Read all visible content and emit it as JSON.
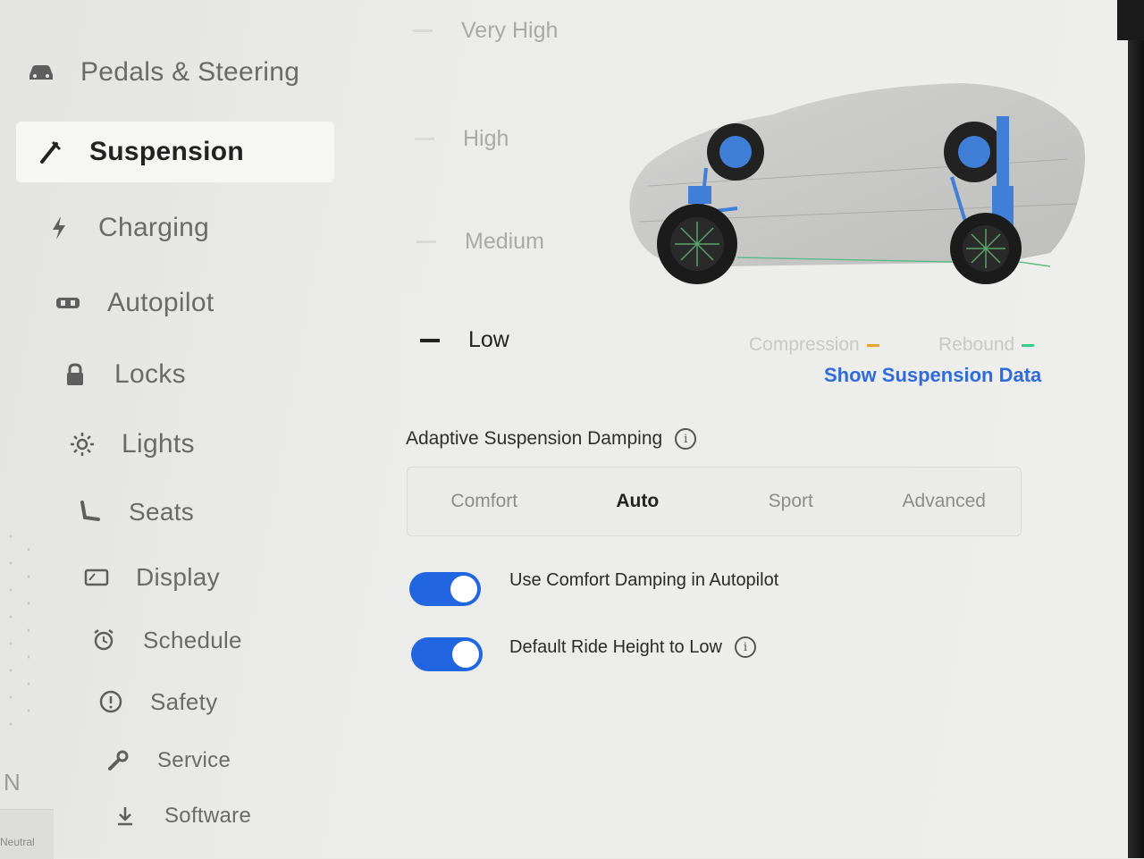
{
  "sidebar": {
    "items": [
      {
        "label": "Pedals & Steering",
        "icon": "car-icon"
      },
      {
        "label": "Suspension",
        "icon": "suspension-icon",
        "active": true
      },
      {
        "label": "Charging",
        "icon": "lightning-icon"
      },
      {
        "label": "Autopilot",
        "icon": "steering-wheel-icon"
      },
      {
        "label": "Locks",
        "icon": "lock-icon"
      },
      {
        "label": "Lights",
        "icon": "sun-icon"
      },
      {
        "label": "Seats",
        "icon": "seat-icon"
      },
      {
        "label": "Display",
        "icon": "display-icon"
      },
      {
        "label": "Schedule",
        "icon": "alarm-clock-icon"
      },
      {
        "label": "Safety",
        "icon": "info-circle-icon"
      },
      {
        "label": "Service",
        "icon": "wrench-icon"
      },
      {
        "label": "Software",
        "icon": "download-icon"
      }
    ]
  },
  "gear": {
    "letter": "N",
    "label": "Neutral"
  },
  "ride_height": {
    "options": [
      "Very High",
      "High",
      "Medium",
      "Low"
    ],
    "selected": "Low"
  },
  "suspension_data": {
    "compression_label": "Compression",
    "rebound_label": "Rebound",
    "compression_color": "#e8a23c",
    "rebound_color": "#3cc98a",
    "show_data_link": "Show Suspension Data"
  },
  "damping": {
    "title": "Adaptive Suspension Damping",
    "options": [
      "Comfort",
      "Auto",
      "Sport",
      "Advanced"
    ],
    "selected": "Auto"
  },
  "toggles": [
    {
      "label": "Use Comfort Damping in Autopilot",
      "on": true
    },
    {
      "label": "Default Ride Height to Low",
      "on": true,
      "info": true
    }
  ],
  "colors": {
    "accent": "#2166e0",
    "link": "#2f6bdc"
  }
}
